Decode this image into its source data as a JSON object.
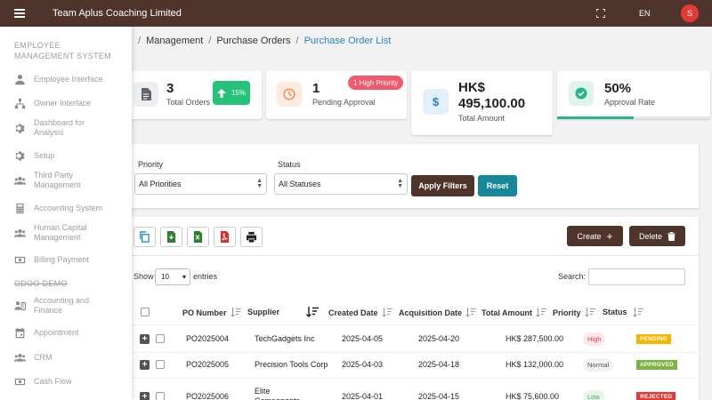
{
  "app": {
    "title": "Team Aplus Coaching Limited",
    "language": "EN",
    "avatar_initial": "S"
  },
  "sidebar": {
    "section1": "EMPLOYEE MANAGEMENT SYSTEM",
    "items1": [
      {
        "label": "Employee Interface",
        "icon": "person-icon"
      },
      {
        "label": "Owner Interface",
        "icon": "sitemap-icon"
      },
      {
        "label": "Dashboard for Analysis",
        "icon": "gear-icon"
      },
      {
        "label": "Setup",
        "icon": "gear-icon"
      },
      {
        "label": "Third Party Management",
        "icon": "users-icon"
      },
      {
        "label": "Accounting System",
        "icon": "calculator-icon"
      },
      {
        "label": "Human Capital Management",
        "icon": "users-icon"
      },
      {
        "label": "Billing Payment",
        "icon": "money-icon"
      }
    ],
    "section2": "ODOO DEMO",
    "items2": [
      {
        "label": "Accounting and Finance",
        "icon": "finance-icon"
      },
      {
        "label": "Appointment",
        "icon": "calendar-icon"
      },
      {
        "label": "CRM",
        "icon": "users-icon"
      },
      {
        "label": "Cash Flow",
        "icon": "money-icon"
      }
    ]
  },
  "breadcrumb": {
    "items": [
      "Management",
      "Purchase Orders",
      "Purchase Order List"
    ]
  },
  "stats": [
    {
      "value": "3",
      "label": "Total Orders",
      "trend": "15%"
    },
    {
      "value": "1",
      "label": "Pending Approval",
      "badge": "1 High Priority"
    },
    {
      "value": "HK$ 495,100.00",
      "label": "Total Amount"
    },
    {
      "value": "50%",
      "label": "Approval Rate",
      "progress": 0.5
    }
  ],
  "filters": {
    "priority_label": "Priority",
    "priority_value": "All Priorities",
    "status_label": "Status",
    "status_value": "All Statuses",
    "apply": "Apply Filters",
    "reset": "Reset"
  },
  "toolbar": {
    "create": "Create",
    "delete": "Delete"
  },
  "table": {
    "show": "Show",
    "entries_value": "10",
    "entries": "entries",
    "search_label": "Search:",
    "columns": [
      "PO Number",
      "Supplier",
      "Created Date",
      "Acquisition Date",
      "Total Amount",
      "Priority",
      "Status"
    ],
    "rows": [
      {
        "po": "PO2025004",
        "supplier": "TechGadgets Inc",
        "created": "2025-04-05",
        "acquisition": "2025-04-20",
        "amount": "HK$ 287,500.00",
        "priority": "High",
        "status": "PENDING"
      },
      {
        "po": "PO2025005",
        "supplier": "Precision Tools Corp",
        "created": "2025-04-03",
        "acquisition": "2025-04-18",
        "amount": "HK$ 132,000.00",
        "priority": "Normal",
        "status": "APPROVED"
      },
      {
        "po": "PO2025006",
        "supplier": "Elite Components",
        "created": "2025-04-01",
        "acquisition": "2025-04-15",
        "amount": "HK$ 75,600.00",
        "priority": "Low",
        "status": "REJECTED"
      }
    ]
  },
  "colors": {
    "brand": "#4f342c",
    "accent": "#17879a",
    "high": "#ef5b6c",
    "pending": "#f7b500",
    "approved": "#7cb342",
    "rejected": "#e53935"
  }
}
